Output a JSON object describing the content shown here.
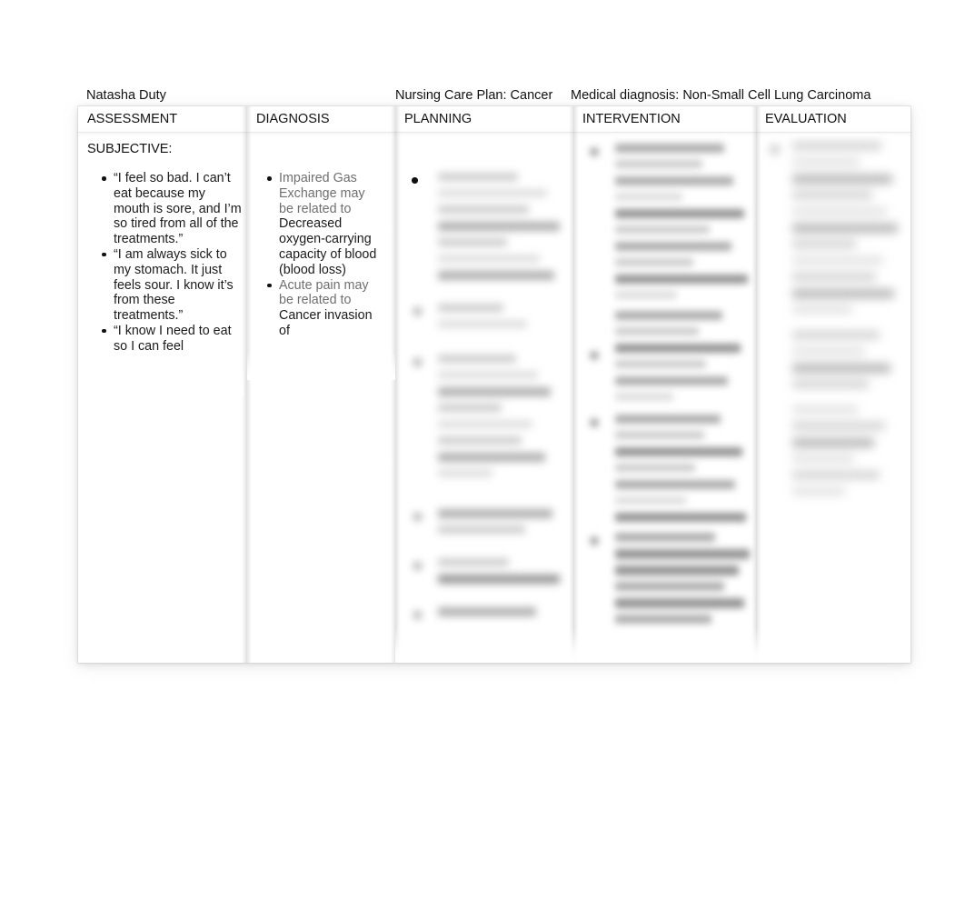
{
  "document": {
    "author": "Natasha Duty",
    "title": "Nursing Care Plan: Cancer",
    "medical_diagnosis": "Medical diagnosis: Non-Small Cell Lung Carcinoma"
  },
  "table": {
    "columns": [
      {
        "header": "ASSESSMENT"
      },
      {
        "header": "DIAGNOSIS"
      },
      {
        "header": "PLANNING"
      },
      {
        "header": "INTERVENTION"
      },
      {
        "header": "EVALUATION"
      }
    ]
  },
  "assessment": {
    "section_label": "SUBJECTIVE:",
    "bullets": [
      "“I feel so bad. I can’t eat because my mouth is sore, and I’m so tired from all of the treatments.”",
      "“I am always sick to my stomach. It just feels sour. I know it’s from these treatments.”",
      "“I know I need to eat so I can feel"
    ]
  },
  "diagnosis": {
    "bullets": [
      {
        "problem": "Impaired Gas Exchange may be related to ",
        "etiology": "Decreased oxygen-carrying capacity of blood (blood loss)"
      },
      {
        "problem": "Acute pain may be related to ",
        "etiology": "Cancer invasion of"
      }
    ]
  },
  "planning": {
    "content_state": "blurred"
  },
  "intervention": {
    "content_state": "blurred"
  },
  "evaluation": {
    "content_state": "blurred"
  },
  "colors": {
    "text": "#1a1a1a",
    "muted_text": "#6f6f6f",
    "page_background": "#ffffff",
    "table_border": "#bebebe"
  }
}
